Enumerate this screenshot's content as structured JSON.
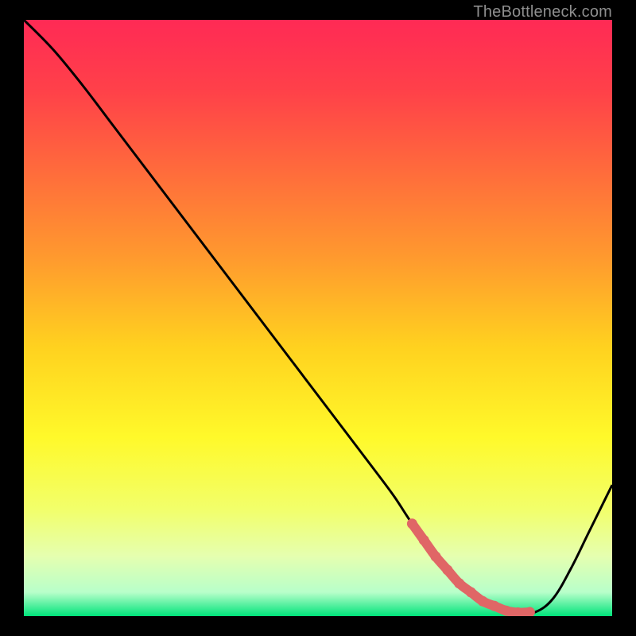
{
  "attribution": "TheBottleneck.com",
  "chart_data": {
    "type": "line",
    "title": "",
    "xlabel": "",
    "ylabel": "",
    "xlim": [
      0,
      100
    ],
    "ylim": [
      0,
      100
    ],
    "x": [
      0,
      5,
      10,
      15,
      20,
      25,
      30,
      35,
      40,
      45,
      50,
      55,
      60,
      63,
      66,
      70,
      74,
      78,
      82,
      84,
      87,
      90,
      93,
      96,
      100
    ],
    "values": [
      100,
      95,
      89,
      82.5,
      76,
      69.5,
      63,
      56.5,
      50,
      43.5,
      37,
      30.5,
      24,
      20,
      15.5,
      10,
      5.5,
      2.5,
      0.9,
      0.6,
      0.7,
      3,
      8,
      14,
      22
    ],
    "highlight_range_x": [
      66,
      86
    ],
    "gradient_stops": [
      {
        "offset": 0.0,
        "color": "#ff2a55"
      },
      {
        "offset": 0.12,
        "color": "#ff4149"
      },
      {
        "offset": 0.25,
        "color": "#ff6a3c"
      },
      {
        "offset": 0.4,
        "color": "#ff9a2e"
      },
      {
        "offset": 0.55,
        "color": "#ffd21f"
      },
      {
        "offset": 0.7,
        "color": "#fff92a"
      },
      {
        "offset": 0.82,
        "color": "#f2ff6a"
      },
      {
        "offset": 0.9,
        "color": "#e5ffb0"
      },
      {
        "offset": 0.96,
        "color": "#b8ffca"
      },
      {
        "offset": 1.0,
        "color": "#00e37a"
      }
    ],
    "curve_color": "#000000",
    "highlight_color": "#e06666"
  }
}
